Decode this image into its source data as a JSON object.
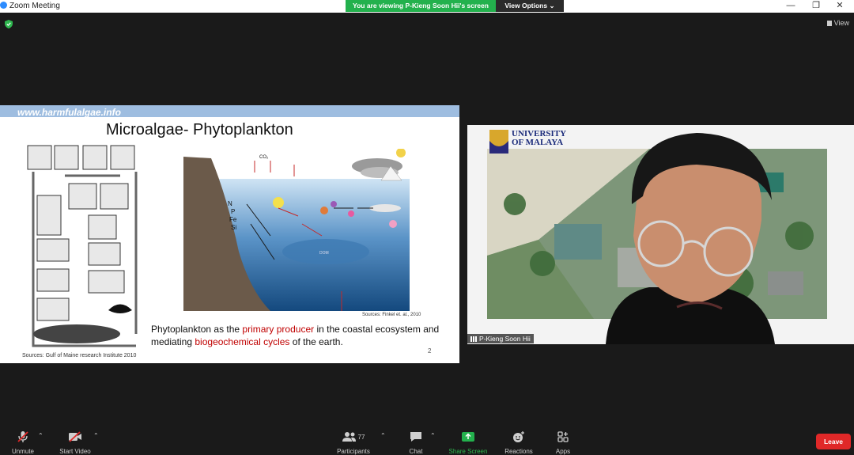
{
  "window": {
    "title": "Zoom Meeting",
    "minimize": "—",
    "restore": "❐",
    "close": "✕"
  },
  "share_banner": {
    "text": "You are viewing P-Kieng Soon Hii's screen",
    "view_options": "View Options ⌄"
  },
  "view_button": "View",
  "slide": {
    "url": "www.harmfulalgae.info",
    "title": "Microalgae- Phytoplankton",
    "text_1": "Phytoplankton as the ",
    "text_red_1": "primary producer",
    "text_2": " in the coastal ecosystem and mediating ",
    "text_red_2": "biogeochemical cycles",
    "text_3": " of the earth.",
    "source_right": "Sources: Finkel et. al., 2010",
    "source_left": "Sources: Gulf of Maine research Institute 2010",
    "page_number": "2",
    "diagram_labels": {
      "co2": "CO₂",
      "nutrients": [
        "N",
        "P",
        "Fe",
        "Si"
      ],
      "dom": "DOM"
    }
  },
  "video": {
    "participant_name": "P-Kieng Soon Hii",
    "university": [
      "UNIVERSITY",
      "OF MALAYA"
    ]
  },
  "toolbar": {
    "unmute": "Unmute",
    "start_video": "Start Video",
    "participants": "Participants",
    "participants_count": "77",
    "chat": "Chat",
    "share_screen": "Share Screen",
    "reactions": "Reactions",
    "apps": "Apps",
    "leave": "Leave"
  },
  "colors": {
    "share_banner": "#23b14d",
    "leave": "#e02828",
    "highlight_text": "#c00000"
  }
}
